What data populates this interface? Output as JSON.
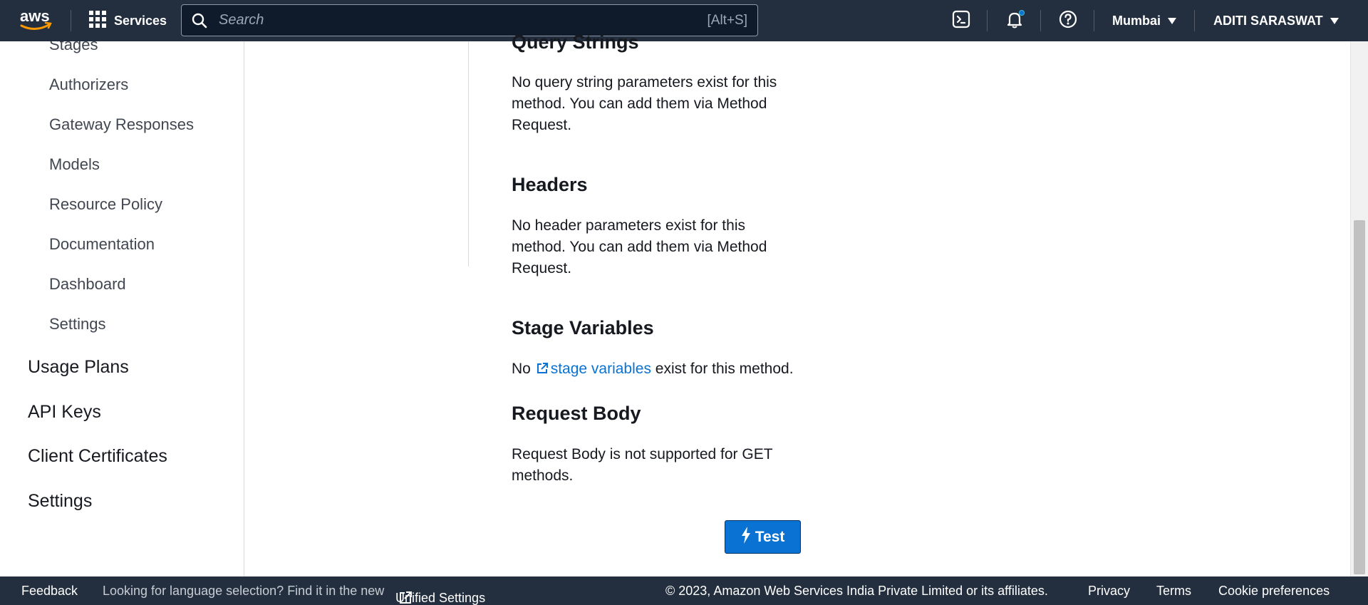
{
  "topnav": {
    "logo_text": "aws",
    "services_label": "Services",
    "search_placeholder": "Search",
    "search_shortcut": "[Alt+S]",
    "region": "Mumbai",
    "user": "ADITI SARASWAT",
    "colors": {
      "bg": "#232f3e",
      "notification_dot": "#0972d3"
    }
  },
  "sidebar": {
    "sub_items": [
      {
        "label": "Stages"
      },
      {
        "label": "Authorizers"
      },
      {
        "label": "Gateway Responses"
      },
      {
        "label": "Models"
      },
      {
        "label": "Resource Policy"
      },
      {
        "label": "Documentation"
      },
      {
        "label": "Dashboard"
      },
      {
        "label": "Settings"
      }
    ],
    "top_items": [
      {
        "label": "Usage Plans"
      },
      {
        "label": "API Keys"
      },
      {
        "label": "Client Certificates"
      },
      {
        "label": "Settings"
      }
    ]
  },
  "main": {
    "query_strings": {
      "heading": "Query Strings",
      "text": "No query string parameters exist for this method. You can add them via Method Request."
    },
    "headers": {
      "heading": "Headers",
      "text": "No header parameters exist for this method. You can add them via Method Request."
    },
    "stage_variables": {
      "heading": "Stage Variables",
      "prefix": "No",
      "link": "stage variables",
      "suffix": "exist for this method."
    },
    "request_body": {
      "heading": "Request Body",
      "text": "Request Body is not supported for GET methods."
    },
    "test_button": "Test",
    "accent_color": "#0972d3"
  },
  "footer": {
    "feedback": "Feedback",
    "language_prompt": "Looking for language selection? Find it in the new",
    "unified_settings": "Unified Settings",
    "copyright": "© 2023, Amazon Web Services India Private Limited or its affiliates.",
    "privacy": "Privacy",
    "terms": "Terms",
    "cookie_preferences": "Cookie preferences"
  }
}
